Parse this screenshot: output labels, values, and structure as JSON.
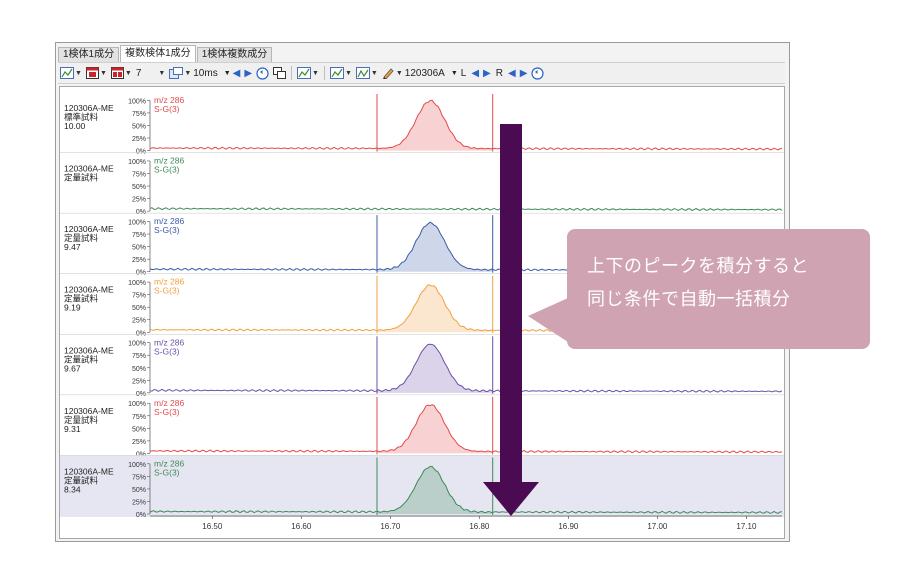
{
  "tabs": [
    {
      "label": "1検体1成分",
      "active": false
    },
    {
      "label": "複数検体1成分",
      "active": true
    },
    {
      "label": "1検体複数成分",
      "active": false
    }
  ],
  "toolbar": {
    "count_value": "7",
    "interval_value": "10ms",
    "sample_select": "120306A",
    "left_label": "L",
    "right_label": "R"
  },
  "colors": {
    "red": "#e34a4a",
    "green": "#3d8a55",
    "blue": "#3a5aa8",
    "orange": "#f0a040",
    "purple": "#6a50a8",
    "callout": "#d0a3b2",
    "arrow": "#4b0b52"
  },
  "callout": {
    "line1": "上下のピークを積分すると",
    "line2": "同じ条件で自動一括積分"
  },
  "chart_data": {
    "type": "line",
    "x_ticks": [
      "16.50",
      "16.60",
      "16.70",
      "16.80",
      "16.90",
      "17.00",
      "17.10"
    ],
    "x_range": [
      16.43,
      17.14
    ],
    "y_ticks": [
      "100%",
      "75%",
      "50%",
      "25%",
      "0%"
    ],
    "integration_window": [
      16.685,
      16.815
    ],
    "peak_center": 16.745,
    "panels": [
      {
        "sample": "120306A-ME",
        "type": "標準試料",
        "value": "10.00",
        "mz": "m/z 286",
        "compound": "S-G(3)",
        "color": "red",
        "peak": 0.95,
        "integrated": true,
        "selected": false
      },
      {
        "sample": "120306A-ME",
        "type": "定量試料",
        "value": "",
        "mz": "m/z 286",
        "compound": "S-G(3)",
        "color": "green",
        "peak": 0.0,
        "integrated": false,
        "selected": false
      },
      {
        "sample": "120306A-ME",
        "type": "定量試料",
        "value": "9.47",
        "mz": "m/z 286",
        "compound": "S-G(3)",
        "color": "blue",
        "peak": 0.93,
        "integrated": true,
        "selected": false
      },
      {
        "sample": "120306A-ME",
        "type": "定量試料",
        "value": "9.19",
        "mz": "m/z 286",
        "compound": "S-G(3)",
        "color": "orange",
        "peak": 0.9,
        "integrated": true,
        "selected": false
      },
      {
        "sample": "120306A-ME",
        "type": "定量試料",
        "value": "9.67",
        "mz": "m/z 286",
        "compound": "S-G(3)",
        "color": "purple",
        "peak": 0.93,
        "integrated": true,
        "selected": false
      },
      {
        "sample": "120306A-ME",
        "type": "定量試料",
        "value": "9.31",
        "mz": "m/z 286",
        "compound": "S-G(3)",
        "color": "red",
        "peak": 0.93,
        "integrated": true,
        "selected": false
      },
      {
        "sample": "120306A-ME",
        "type": "定量試料",
        "value": "8.34",
        "mz": "m/z 286",
        "compound": "S-G(3)",
        "color": "green",
        "peak": 0.9,
        "integrated": true,
        "selected": true
      }
    ]
  }
}
